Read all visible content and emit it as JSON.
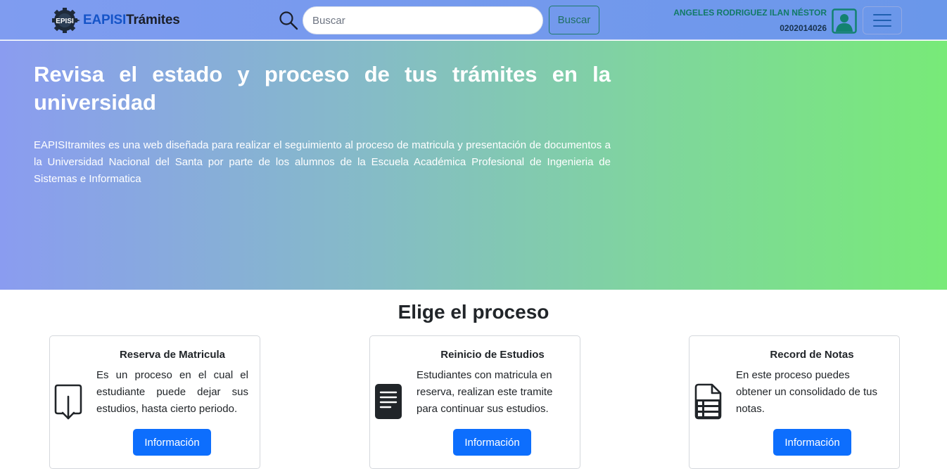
{
  "navbar": {
    "brand_part1": "EAPISI",
    "brand_part2": "Trámites",
    "logo_label": "EPISI",
    "search_placeholder": "Buscar",
    "search_button": "Buscar",
    "user_name": "ANGELES RODRIGUEZ ILAN NÉSTOR",
    "user_code": "0202014026"
  },
  "hero": {
    "title": "Revisa el estado y proceso de tus trámites en la universidad",
    "text": "EAPISItramites es una web diseñada para realizar el seguimiento al proceso de matricula y presentación de documentos a la Universidad Nacional del Santa por parte de los alumnos de la Escuela Académica Profesional de Ingenieria de Sistemas e Informatica"
  },
  "section": {
    "title": "Elige el proceso"
  },
  "cards": [
    {
      "title": "Reserva de Matricula",
      "description": "Es un proceso en el cual el estudiante puede dejar sus estudios, hasta cierto periodo.",
      "button": "Información",
      "icon": "box-arrow-in-down-icon"
    },
    {
      "title": "Reinicio de Estudios",
      "description": "Estudiantes con matricula en reserva, realizan este tramite para continuar sus estudios.",
      "button": "Información",
      "icon": "file-text-icon"
    },
    {
      "title": "Record de Notas",
      "description": "En este proceso puedes obtener un consolidado de tus notas.",
      "button": "Información",
      "icon": "file-spreadsheet-icon"
    }
  ],
  "colors": {
    "primary_button": "#0d6efd",
    "brand_accent": "#1554c8",
    "user_name": "#117a66"
  }
}
